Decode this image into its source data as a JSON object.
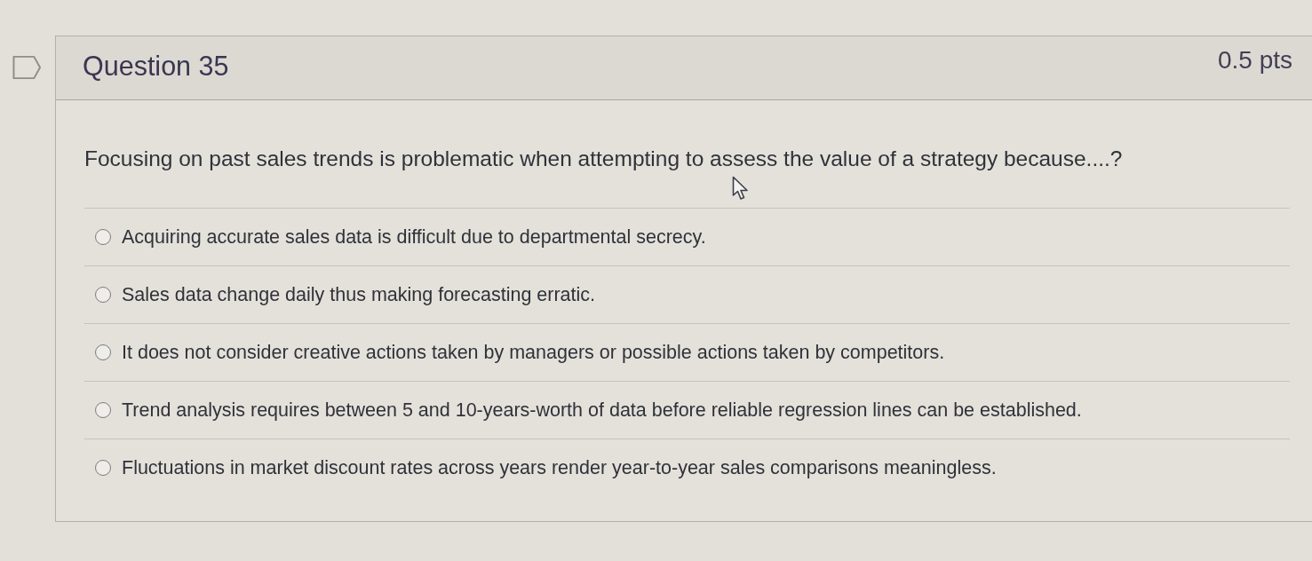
{
  "question": {
    "title": "Question 35",
    "points": "0.5 pts",
    "text": "Focusing on past sales trends is problematic when attempting to assess the value of a strategy because....?",
    "options": [
      {
        "label": "Acquiring accurate sales data is difficult due to departmental secrecy.",
        "selected": false
      },
      {
        "label": "Sales data change daily thus making forecasting erratic.",
        "selected": false
      },
      {
        "label": "It does not consider creative actions taken by managers or possible actions taken by competitors.",
        "selected": false
      },
      {
        "label": "Trend analysis requires between 5 and 10-years-worth of data before reliable regression lines can be established.",
        "selected": false
      },
      {
        "label": "Fluctuations in market discount rates across years render year-to-year sales comparisons meaningless.",
        "selected": false
      }
    ]
  }
}
